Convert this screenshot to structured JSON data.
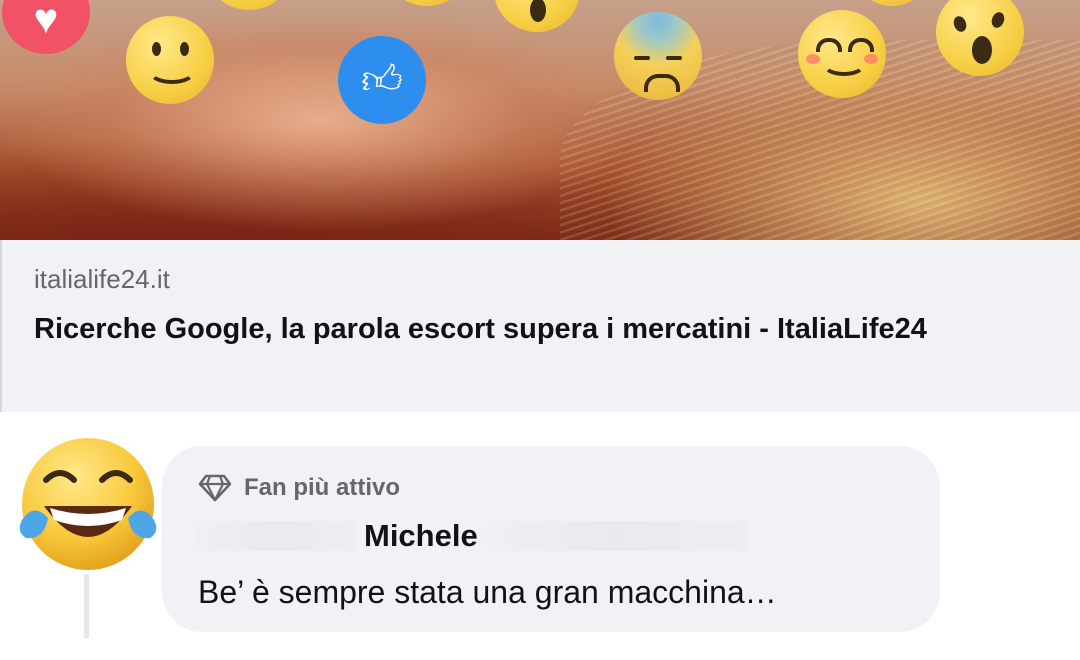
{
  "reactions": {
    "icons": [
      "heart-icon",
      "smile-icon",
      "thumbs-up-icon",
      "surprised-icon",
      "sad-icon",
      "blush-icon",
      "wow-icon",
      "laugh-tears-icon"
    ],
    "colors": {
      "like": "#2e8ef0",
      "love": "#f25268",
      "emoji": "#f7cf45"
    }
  },
  "link_preview": {
    "domain": "italialife24.it",
    "title": "Ricerche Google, la parola escort supera i mercatini - ItaliaLife24"
  },
  "comment": {
    "badge_icon": "diamond-icon",
    "badge_label": "Fan più attivo",
    "author_visible": "Michele",
    "text": "Be’ è sempre stata una gran macchina…"
  }
}
